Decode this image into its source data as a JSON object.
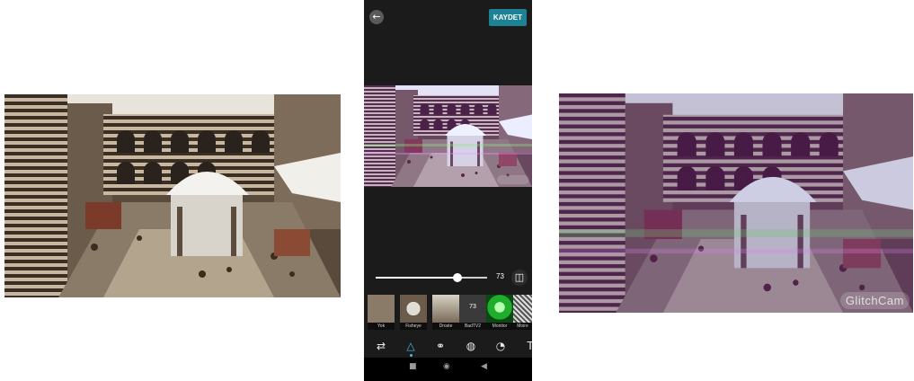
{
  "left_photo": {
    "description_icon": "courtyard-photo"
  },
  "right_photo": {
    "watermark": "GlitchCam"
  },
  "phone": {
    "save_label": "KAYDET",
    "back_icon": "arrow-left-icon",
    "slider": {
      "value": 73,
      "value_text": "73",
      "max": 100
    },
    "filters": [
      {
        "label": "Yok"
      },
      {
        "label": "Fisheye"
      },
      {
        "label": "Droste"
      },
      {
        "label": "BadTV2",
        "value_text": "73",
        "selected": true
      },
      {
        "label": "Monitor"
      },
      {
        "label": "Moire"
      }
    ],
    "tools": [
      "adjust-icon",
      "triangle-icon",
      "circles-icon",
      "ball-icon",
      "pacman-icon",
      "text-icon"
    ],
    "active_tool": "triangle-icon",
    "colors": {
      "accent": "#1d8294",
      "active": "#4db6e6",
      "background": "#1b1b1b"
    }
  }
}
